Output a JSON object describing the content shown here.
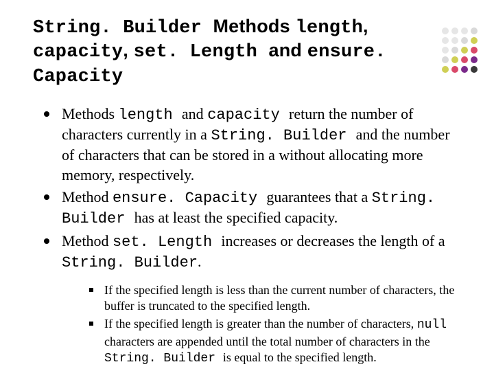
{
  "deco_colors": [
    "#e6e6e6",
    "#e6e6e6",
    "#e6e6e6",
    "#d9d9d9",
    "#e6e6e6",
    "#e6e6e6",
    "#d9d9d9",
    "#cfcf55",
    "#e6e6e6",
    "#d9d9d9",
    "#cfcf55",
    "#d94a6a",
    "#d9d9d9",
    "#cfcf55",
    "#d94a6a",
    "#7a2a8a",
    "#cfcf55",
    "#d94a6a",
    "#7a2a8a",
    "#3a3a3a"
  ],
  "title": [
    {
      "t": "String. Builder ",
      "code": true
    },
    {
      "t": "Methods ",
      "code": false
    },
    {
      "t": "length",
      "code": true
    },
    {
      "t": ", ",
      "code": false
    },
    {
      "t": "capacity",
      "code": true
    },
    {
      "t": ", ",
      "code": false
    },
    {
      "t": "set. Length ",
      "code": true
    },
    {
      "t": "and ",
      "code": false
    },
    {
      "t": "ensure. Capacity",
      "code": true
    }
  ],
  "bullets": [
    [
      {
        "t": "Methods ",
        "code": false
      },
      {
        "t": "length ",
        "code": true
      },
      {
        "t": "and ",
        "code": false
      },
      {
        "t": "capacity ",
        "code": true
      },
      {
        "t": "return the number of characters currently in a ",
        "code": false
      },
      {
        "t": "String. Builder ",
        "code": true
      },
      {
        "t": "and the number of characters that can be stored in a without allocating more memory, respectively.",
        "code": false
      }
    ],
    [
      {
        "t": "Method ",
        "code": false
      },
      {
        "t": "ensure. Capacity ",
        "code": true
      },
      {
        "t": "guarantees that a ",
        "code": false
      },
      {
        "t": "String. Builder ",
        "code": true
      },
      {
        "t": "has at least the specified capacity.",
        "code": false
      }
    ],
    [
      {
        "t": "Method ",
        "code": false
      },
      {
        "t": "set. Length ",
        "code": true
      },
      {
        "t": "increases or decreases the length of a ",
        "code": false
      },
      {
        "t": "String. Builder",
        "code": true
      },
      {
        "t": ".",
        "code": false
      }
    ]
  ],
  "sub_bullets": [
    [
      {
        "t": "If the specified length is less than the current number of characters, the buffer is truncated to the specified length.",
        "code": false
      }
    ],
    [
      {
        "t": "If the specified length is greater than the number of characters, ",
        "code": false
      },
      {
        "t": "null ",
        "code": true
      },
      {
        "t": "characters  are appended until the total number of characters in the ",
        "code": false
      },
      {
        "t": "String. Builder ",
        "code": true
      },
      {
        "t": "is equal to the specified length.",
        "code": false
      }
    ]
  ]
}
